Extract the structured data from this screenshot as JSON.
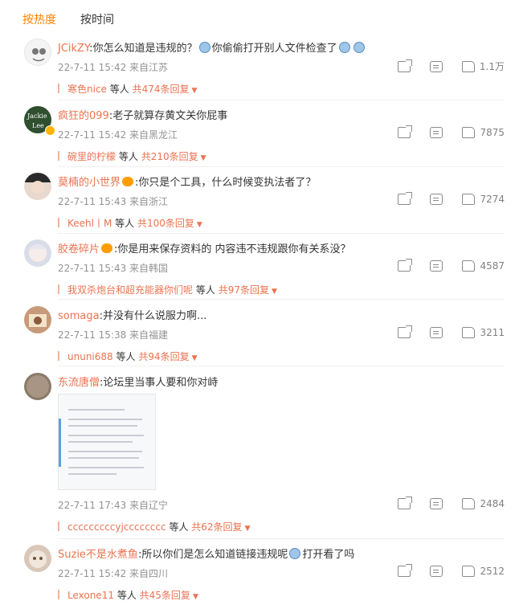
{
  "tabs": [
    {
      "label": "按热度",
      "active": true
    },
    {
      "label": "按时间",
      "active": false
    }
  ],
  "comments": [
    {
      "user": "JCikZY",
      "text": "你怎么知道是违规的？",
      "text2": "你偷偷打开别人文件检查了",
      "emoji": "doge",
      "meta": "22-7-11 15:42 来自江苏",
      "likes": "1.1万",
      "reply_name": "寒色nice",
      "reply_mid": "等人",
      "reply_total": "共474条回复"
    },
    {
      "user": "疯狂的099",
      "text": "老子就算存黄文关你屁事",
      "meta": "22-7-11 15:42 来自黑龙江",
      "likes": "7875",
      "reply_name": "碗里的柠檬",
      "reply_mid": "等人",
      "reply_total": "共210条回复"
    },
    {
      "user": "莫楠的小世界",
      "text": "你只是个工具，什么时候变执法者了？",
      "meta": "22-7-11 15:43 来自浙江",
      "likes": "7274",
      "reply_name": "Keehl丨M",
      "reply_mid": "等人",
      "reply_total": "共100条回复"
    },
    {
      "user": "胶卷碎片",
      "text": "你是用来保存资料的 内容违不违规跟你有关系没？",
      "meta": "22-7-11 15:43 来自韩国",
      "likes": "4587",
      "reply_name": "我双杀炮台和超充能器你们呢",
      "reply_mid": "等人",
      "reply_total": "共97条回复"
    },
    {
      "user": "somaga",
      "text": "并没有什么说服力啊...",
      "meta": "22-7-11 15:38 来自福建",
      "likes": "3211",
      "reply_name": "ununi688",
      "reply_mid": "等人",
      "reply_total": "共94条回复"
    },
    {
      "user": "东流唐僧",
      "text": "论坛里当事人要和你对峙",
      "meta": "22-7-11 17:43 来自辽宁",
      "likes": "2484",
      "reply_name": "cccccccccyjcccccccc",
      "reply_mid": "等人",
      "reply_total": "共62条回复"
    },
    {
      "user": "Suzie不是水煮鱼",
      "text": "所以你们是怎么知道链接违规呢",
      "text2": "打开看了吗",
      "emoji": "doge",
      "meta": "22-7-11 15:42 来自四川",
      "likes": "2512",
      "reply_name": "Lexone11",
      "reply_mid": "等人",
      "reply_total": "共45条回复"
    }
  ]
}
